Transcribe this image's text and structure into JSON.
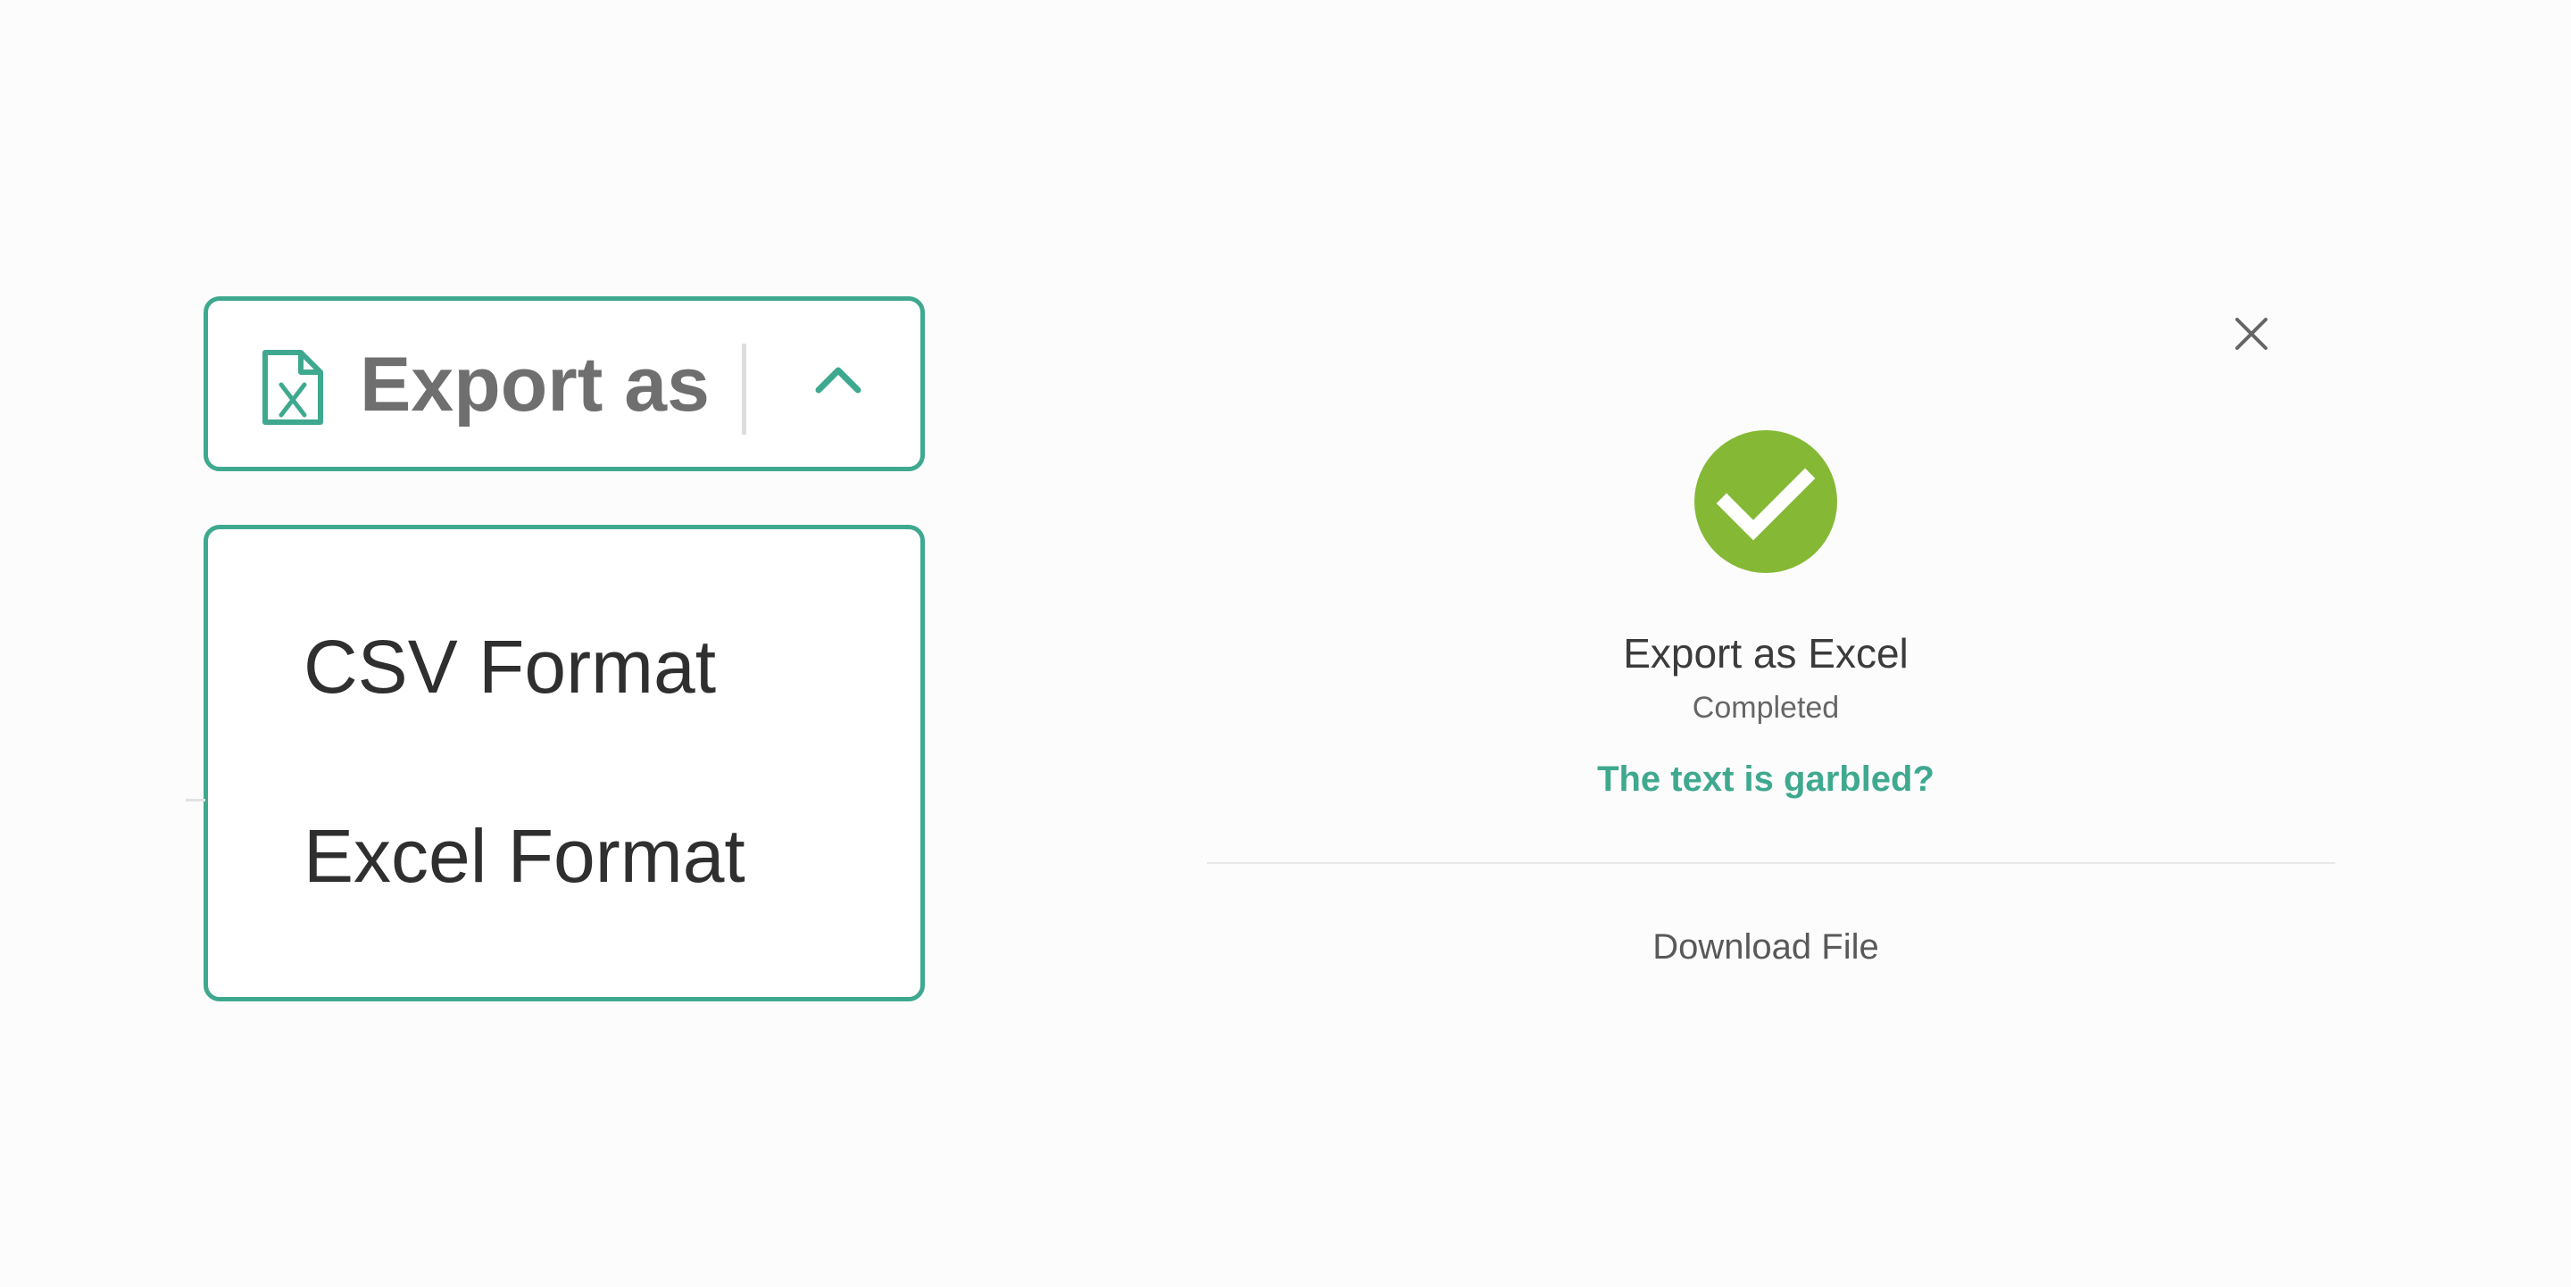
{
  "export_control": {
    "label": "Export as",
    "icon": "excel-file-icon",
    "toggle_icon": "chevron-up-icon",
    "accent_color": "#3fa98f"
  },
  "dropdown": {
    "items": [
      {
        "label": "CSV Format"
      },
      {
        "label": "Excel Format"
      }
    ]
  },
  "dialog": {
    "close_icon": "close-icon",
    "status_icon": "check-circle-icon",
    "status_icon_color": "#85b935",
    "title": "Export as Excel",
    "status": "Completed",
    "help_link": "The text is garbled?",
    "action": "Download File"
  }
}
